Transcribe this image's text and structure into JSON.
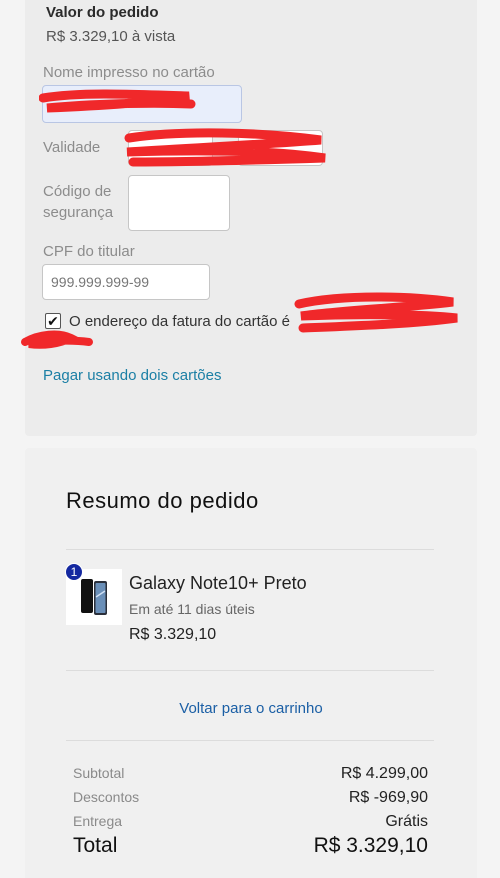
{
  "payment": {
    "order_label": "Valor do pedido",
    "order_value": "R$ 3.329,10 à vista",
    "name_label": "Nome impresso no cartão",
    "validity_label": "Validade",
    "cvv_label": "Código de segurança",
    "cpf_label": "CPF do titular",
    "cpf_placeholder": "999.999.999-99",
    "billing_checkbox_label": "O endereço da fatura do cartão é",
    "billing_checked": true,
    "two_cards_link": "Pagar usando dois cartões",
    "redaction_color": "#f0282a"
  },
  "summary": {
    "title": "Resumo do pedido",
    "item": {
      "quantity": "1",
      "name": "Galaxy Note10+ Preto",
      "shipping": "Em até 11 dias úteis",
      "price": "R$ 3.329,10"
    },
    "back_link": "Voltar para o carrinho",
    "rows": [
      {
        "label": "Subtotal",
        "value": "R$ 4.299,00"
      },
      {
        "label": "Descontos",
        "value": "R$ -969,90"
      },
      {
        "label": "Entrega",
        "value": "Grátis"
      }
    ],
    "total": {
      "label": "Total",
      "value": "R$ 3.329,10"
    }
  },
  "colors": {
    "link": "#1b7fa5",
    "badge": "#1428a0"
  }
}
